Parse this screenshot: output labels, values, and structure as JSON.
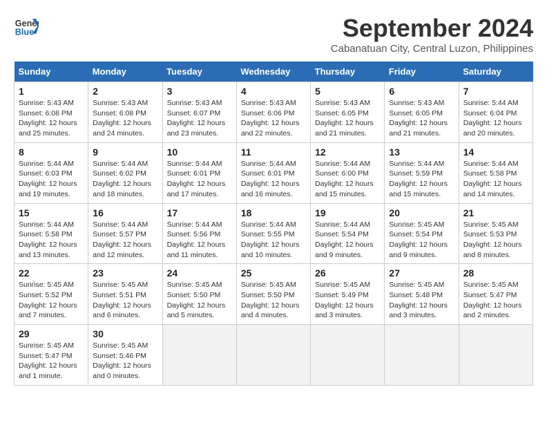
{
  "header": {
    "logo_line1": "General",
    "logo_line2": "Blue",
    "month_title": "September 2024",
    "subtitle": "Cabanatuan City, Central Luzon, Philippines"
  },
  "days_of_week": [
    "Sunday",
    "Monday",
    "Tuesday",
    "Wednesday",
    "Thursday",
    "Friday",
    "Saturday"
  ],
  "weeks": [
    [
      {
        "day": "1",
        "detail": "Sunrise: 5:43 AM\nSunset: 6:08 PM\nDaylight: 12 hours\nand 25 minutes."
      },
      {
        "day": "2",
        "detail": "Sunrise: 5:43 AM\nSunset: 6:08 PM\nDaylight: 12 hours\nand 24 minutes."
      },
      {
        "day": "3",
        "detail": "Sunrise: 5:43 AM\nSunset: 6:07 PM\nDaylight: 12 hours\nand 23 minutes."
      },
      {
        "day": "4",
        "detail": "Sunrise: 5:43 AM\nSunset: 6:06 PM\nDaylight: 12 hours\nand 22 minutes."
      },
      {
        "day": "5",
        "detail": "Sunrise: 5:43 AM\nSunset: 6:05 PM\nDaylight: 12 hours\nand 21 minutes."
      },
      {
        "day": "6",
        "detail": "Sunrise: 5:43 AM\nSunset: 6:05 PM\nDaylight: 12 hours\nand 21 minutes."
      },
      {
        "day": "7",
        "detail": "Sunrise: 5:44 AM\nSunset: 6:04 PM\nDaylight: 12 hours\nand 20 minutes."
      }
    ],
    [
      {
        "day": "8",
        "detail": "Sunrise: 5:44 AM\nSunset: 6:03 PM\nDaylight: 12 hours\nand 19 minutes."
      },
      {
        "day": "9",
        "detail": "Sunrise: 5:44 AM\nSunset: 6:02 PM\nDaylight: 12 hours\nand 18 minutes."
      },
      {
        "day": "10",
        "detail": "Sunrise: 5:44 AM\nSunset: 6:01 PM\nDaylight: 12 hours\nand 17 minutes."
      },
      {
        "day": "11",
        "detail": "Sunrise: 5:44 AM\nSunset: 6:01 PM\nDaylight: 12 hours\nand 16 minutes."
      },
      {
        "day": "12",
        "detail": "Sunrise: 5:44 AM\nSunset: 6:00 PM\nDaylight: 12 hours\nand 15 minutes."
      },
      {
        "day": "13",
        "detail": "Sunrise: 5:44 AM\nSunset: 5:59 PM\nDaylight: 12 hours\nand 15 minutes."
      },
      {
        "day": "14",
        "detail": "Sunrise: 5:44 AM\nSunset: 5:58 PM\nDaylight: 12 hours\nand 14 minutes."
      }
    ],
    [
      {
        "day": "15",
        "detail": "Sunrise: 5:44 AM\nSunset: 5:58 PM\nDaylight: 12 hours\nand 13 minutes."
      },
      {
        "day": "16",
        "detail": "Sunrise: 5:44 AM\nSunset: 5:57 PM\nDaylight: 12 hours\nand 12 minutes."
      },
      {
        "day": "17",
        "detail": "Sunrise: 5:44 AM\nSunset: 5:56 PM\nDaylight: 12 hours\nand 11 minutes."
      },
      {
        "day": "18",
        "detail": "Sunrise: 5:44 AM\nSunset: 5:55 PM\nDaylight: 12 hours\nand 10 minutes."
      },
      {
        "day": "19",
        "detail": "Sunrise: 5:44 AM\nSunset: 5:54 PM\nDaylight: 12 hours\nand 9 minutes."
      },
      {
        "day": "20",
        "detail": "Sunrise: 5:45 AM\nSunset: 5:54 PM\nDaylight: 12 hours\nand 9 minutes."
      },
      {
        "day": "21",
        "detail": "Sunrise: 5:45 AM\nSunset: 5:53 PM\nDaylight: 12 hours\nand 8 minutes."
      }
    ],
    [
      {
        "day": "22",
        "detail": "Sunrise: 5:45 AM\nSunset: 5:52 PM\nDaylight: 12 hours\nand 7 minutes."
      },
      {
        "day": "23",
        "detail": "Sunrise: 5:45 AM\nSunset: 5:51 PM\nDaylight: 12 hours\nand 6 minutes."
      },
      {
        "day": "24",
        "detail": "Sunrise: 5:45 AM\nSunset: 5:50 PM\nDaylight: 12 hours\nand 5 minutes."
      },
      {
        "day": "25",
        "detail": "Sunrise: 5:45 AM\nSunset: 5:50 PM\nDaylight: 12 hours\nand 4 minutes."
      },
      {
        "day": "26",
        "detail": "Sunrise: 5:45 AM\nSunset: 5:49 PM\nDaylight: 12 hours\nand 3 minutes."
      },
      {
        "day": "27",
        "detail": "Sunrise: 5:45 AM\nSunset: 5:48 PM\nDaylight: 12 hours\nand 3 minutes."
      },
      {
        "day": "28",
        "detail": "Sunrise: 5:45 AM\nSunset: 5:47 PM\nDaylight: 12 hours\nand 2 minutes."
      }
    ],
    [
      {
        "day": "29",
        "detail": "Sunrise: 5:45 AM\nSunset: 5:47 PM\nDaylight: 12 hours\nand 1 minute."
      },
      {
        "day": "30",
        "detail": "Sunrise: 5:45 AM\nSunset: 5:46 PM\nDaylight: 12 hours\nand 0 minutes."
      },
      null,
      null,
      null,
      null,
      null
    ]
  ]
}
